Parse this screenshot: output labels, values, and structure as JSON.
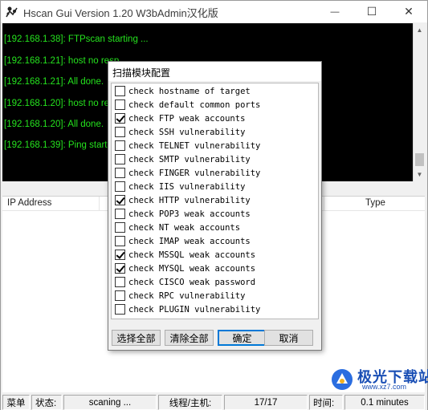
{
  "window": {
    "title": "Hscan Gui Version 1.20 W3bAdmin汉化版",
    "minimize_glyph": "—",
    "maximize_glyph": "☐",
    "close_glyph": "✕"
  },
  "console": {
    "lines": [
      "[192.168.1.38]: FTPscan starting ...",
      "[192.168.1.21]: host no resp",
      "[192.168.1.21]: All done.",
      "[192.168.1.20]: host no resp",
      "[192.168.1.20]: All done.",
      "[192.168.1.39]: Ping starting"
    ],
    "text_color": "#25e31e"
  },
  "listview": {
    "columns": [
      "IP Address",
      "Type"
    ]
  },
  "dialog": {
    "title": "扫描模块配置",
    "options": [
      {
        "label": "check hostname of target",
        "checked": false
      },
      {
        "label": "check default common ports",
        "checked": false
      },
      {
        "label": "check FTP weak accounts",
        "checked": true
      },
      {
        "label": "check SSH vulnerability",
        "checked": false
      },
      {
        "label": "check TELNET vulnerability",
        "checked": false
      },
      {
        "label": "check SMTP vulnerability",
        "checked": false
      },
      {
        "label": "check FINGER vulnerability",
        "checked": false
      },
      {
        "label": "check IIS vulnerability",
        "checked": false
      },
      {
        "label": "check HTTP vulnerability",
        "checked": true
      },
      {
        "label": "check POP3 weak accounts",
        "checked": false
      },
      {
        "label": "check NT weak accounts",
        "checked": false
      },
      {
        "label": "check IMAP weak accounts",
        "checked": false
      },
      {
        "label": "check MSSQL weak accounts",
        "checked": true
      },
      {
        "label": "check MYSQL weak accounts",
        "checked": true
      },
      {
        "label": "check CISCO weak password",
        "checked": false
      },
      {
        "label": "check RPC vulnerability",
        "checked": false
      },
      {
        "label": "check PLUGIN vulnerability",
        "checked": false
      }
    ],
    "buttons": {
      "select_all": "选择全部",
      "clear_all": "清除全部",
      "ok": "确定",
      "cancel": "取消"
    }
  },
  "statusbar": {
    "menu": "菜单",
    "state_label": "状态:",
    "state_value": "scaning ...",
    "threads_label": "线程/主机:",
    "threads_value": "17/17",
    "time_label": "时间:",
    "time_value": "0.1 minutes"
  },
  "watermark": {
    "text": "极光下载站",
    "url": "www.xz7.com"
  }
}
